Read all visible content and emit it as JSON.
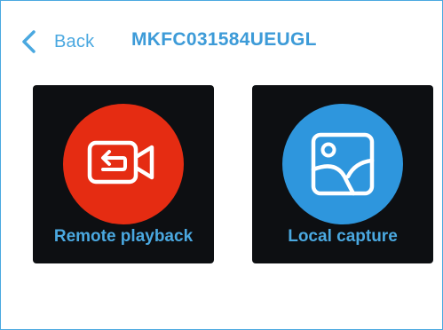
{
  "header": {
    "back_label": "Back",
    "title": "MKFC031584UEUGL"
  },
  "tiles": [
    {
      "label": "Remote playback",
      "icon": "video-playback-icon",
      "color": "#e52c12"
    },
    {
      "label": "Local capture",
      "icon": "image-icon",
      "color": "#2e96dd"
    }
  ],
  "colors": {
    "accent": "#4aa8e0",
    "tile_background": "#0d0f12"
  }
}
